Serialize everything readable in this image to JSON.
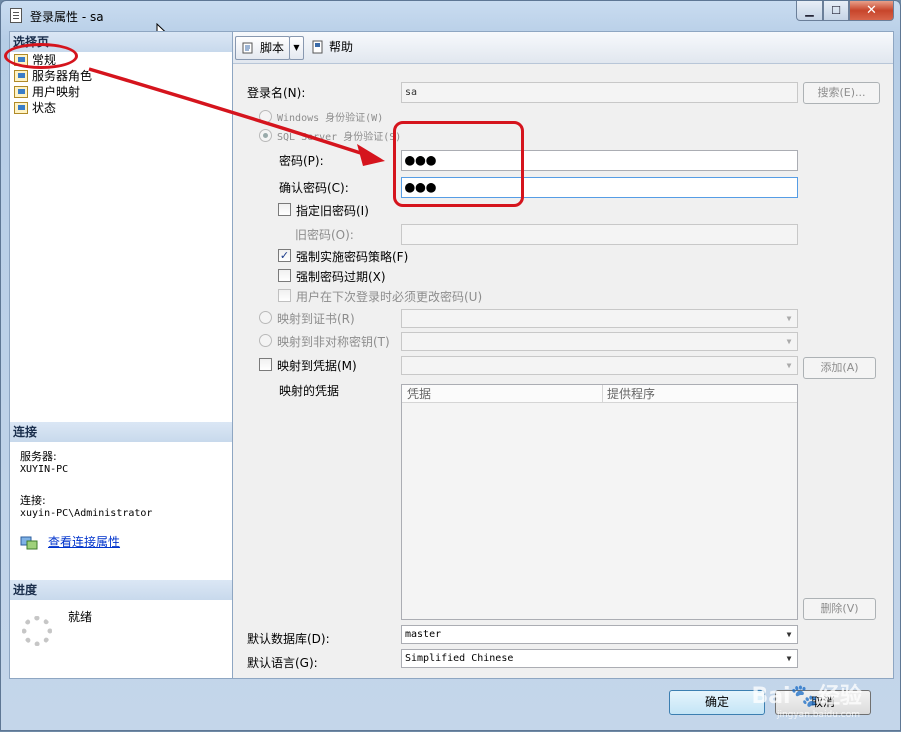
{
  "window": {
    "title": "登录属性 - sa",
    "min_label": "▁",
    "max_label": "☐",
    "close_label": "✕"
  },
  "left_panel": {
    "select_page_title": "选择页",
    "pages": [
      "常规",
      "服务器角色",
      "用户映射",
      "状态"
    ],
    "connection": {
      "title": "连接",
      "server_label": "服务器:",
      "server_value": "XUYIN-PC",
      "conn_label": "连接:",
      "conn_value": "xuyin-PC\\Administrator",
      "link_label": "查看连接属性"
    },
    "progress": {
      "title": "进度",
      "status": "就绪"
    }
  },
  "toolbar": {
    "script_label": "脚本",
    "dropdown_glyph": "▼",
    "help_label": "帮助"
  },
  "form": {
    "login_name_label": "登录名(N):",
    "login_name_value": "sa",
    "search_button": "搜索(E)...",
    "windows_auth": "Windows 身份验证(W)",
    "sql_auth": "SQL Server 身份验证(S)",
    "password_label": "密码(P):",
    "password_value": "●●●",
    "confirm_label": "确认密码(C):",
    "confirm_value": "●●●",
    "specify_old": "指定旧密码(I)",
    "old_password_label": "旧密码(O):",
    "enforce_policy": "强制实施密码策略(F)",
    "enforce_expiration": "强制密码过期(X)",
    "must_change": "用户在下次登录时必须更改密码(U)",
    "map_cert": "映射到证书(R)",
    "map_asym": "映射到非对称密钥(T)",
    "map_cred": "映射到凭据(M)",
    "add_button": "添加(A)",
    "mapped_creds_label": "映射的凭据",
    "grid_col1": "凭据",
    "grid_col2": "提供程序",
    "remove_button": "删除(V)",
    "default_db_label": "默认数据库(D):",
    "default_db_value": "master",
    "default_lang_label": "默认语言(G):",
    "default_lang_value": "Simplified Chinese",
    "checked_glyph": "✓",
    "dropdown_glyph": "▼"
  },
  "footer": {
    "ok_button": "确定",
    "cancel_button": "取消"
  },
  "watermark": {
    "brand": "Bai🐾经验",
    "url": "jingyan.baidu.com"
  },
  "colors": {
    "annotation": "#d5141d",
    "link": "#0033cc"
  }
}
